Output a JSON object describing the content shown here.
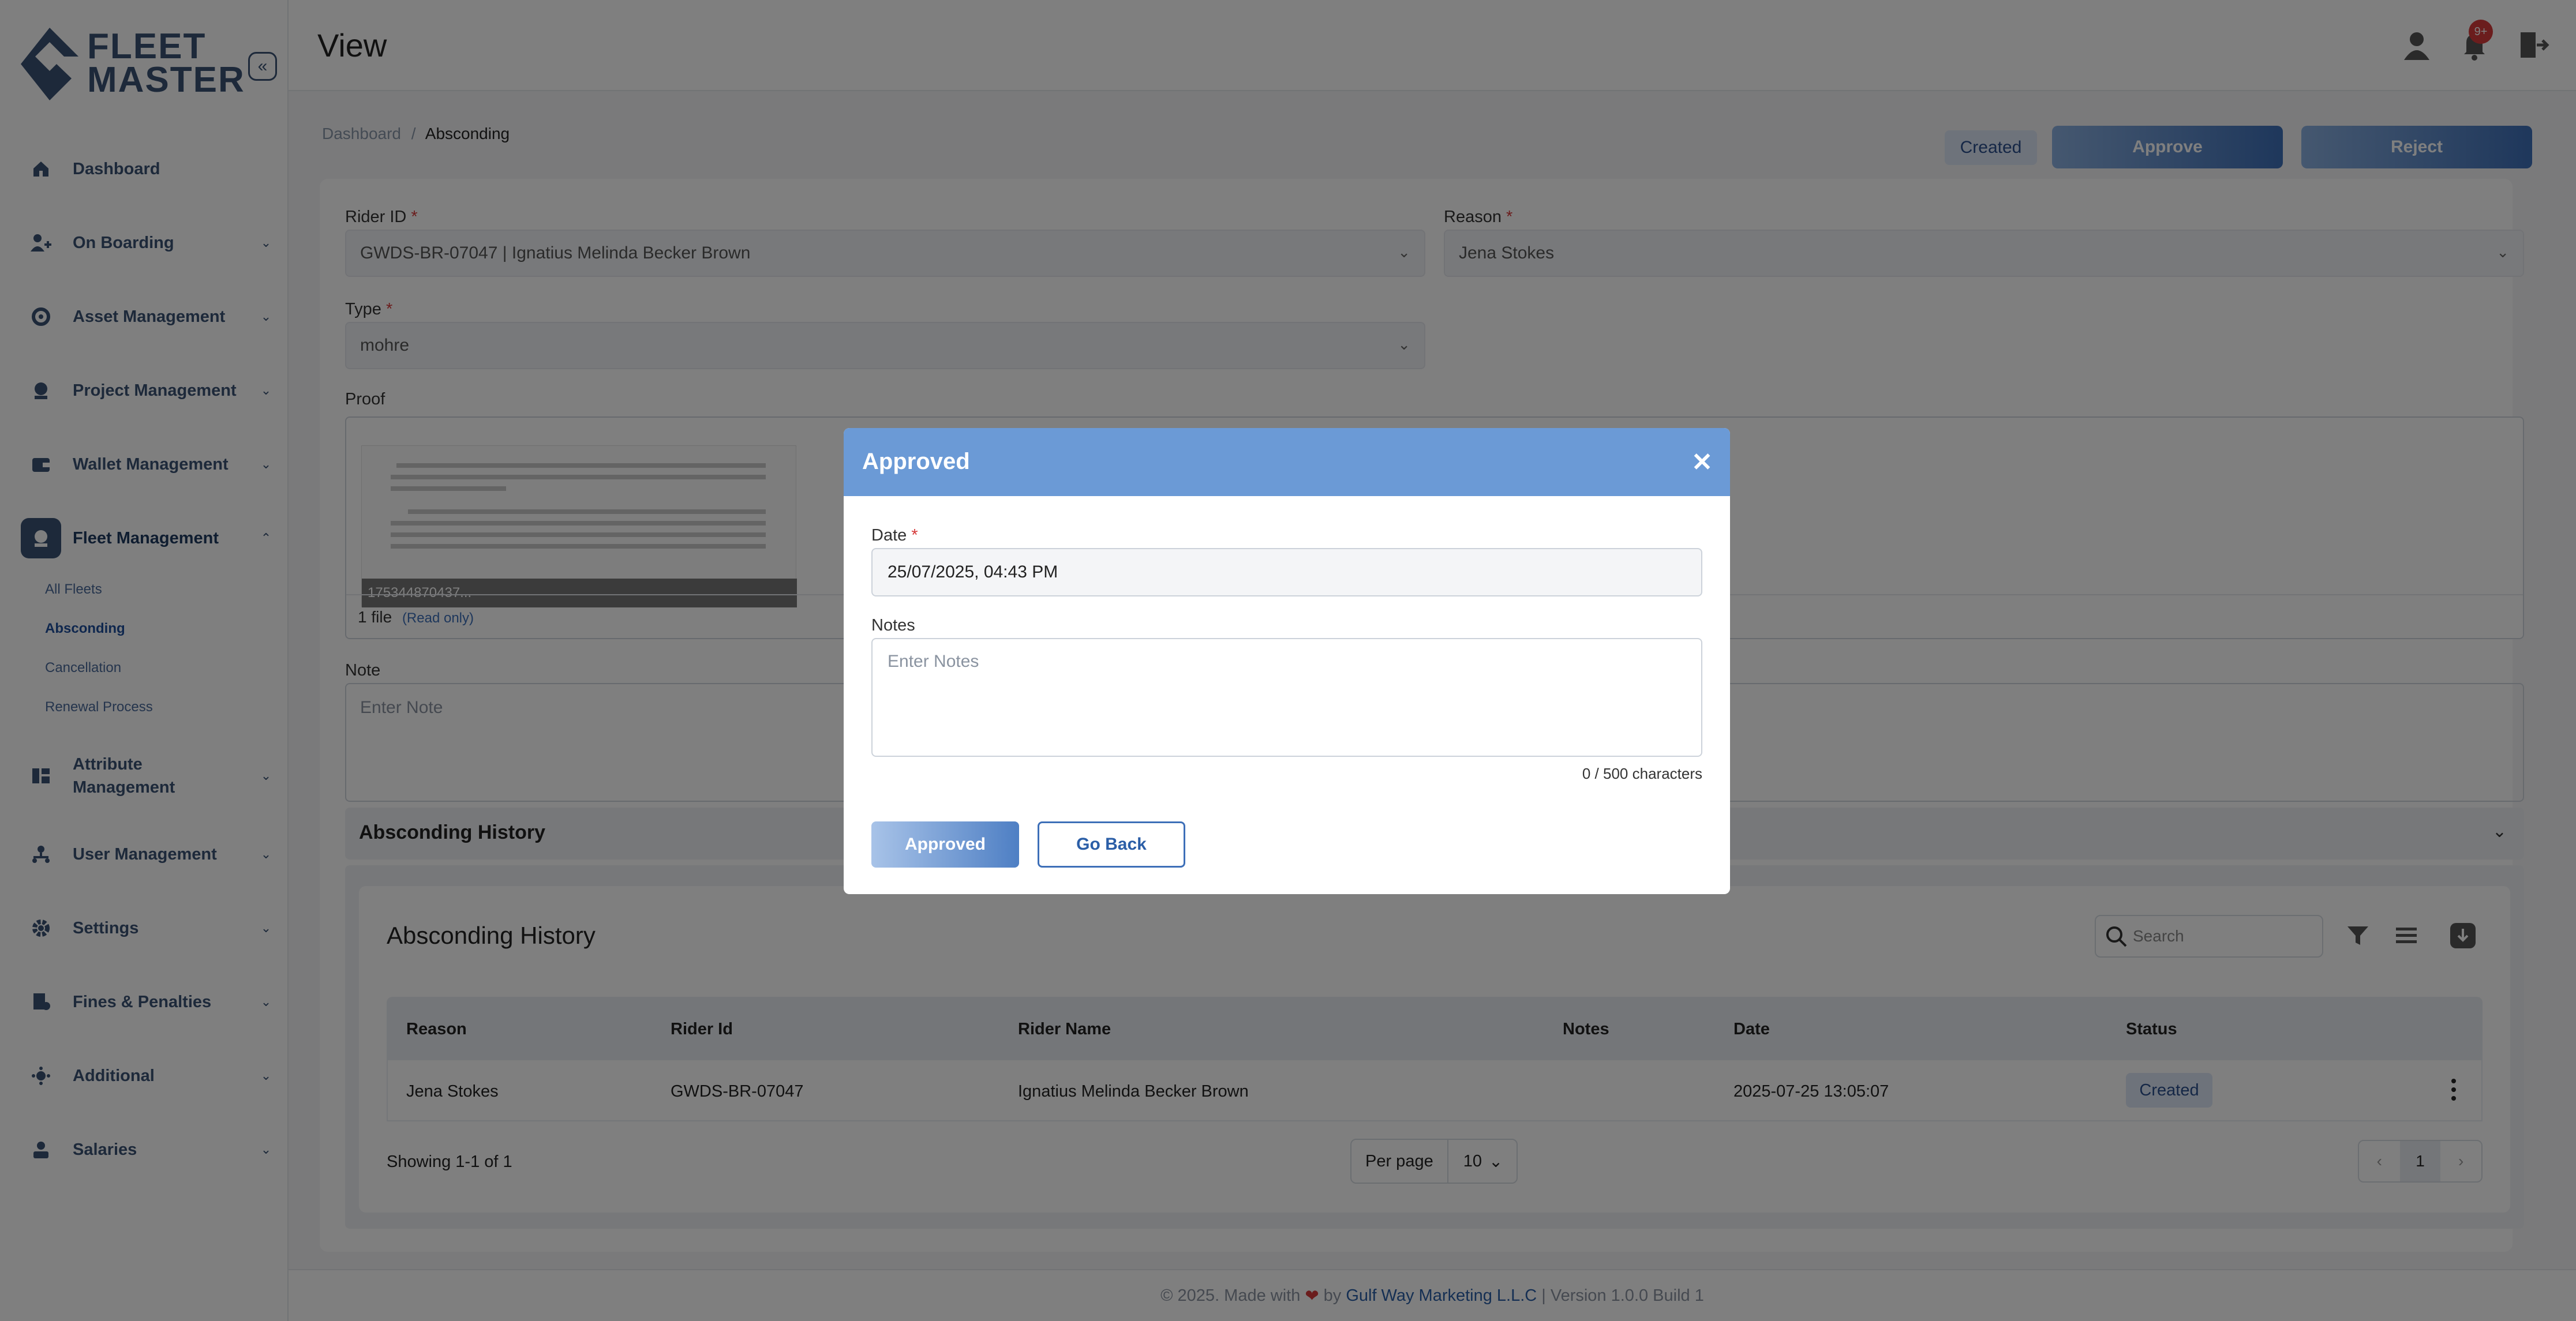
{
  "brand": {
    "logo_line1": "FLEET",
    "logo_line2": "MASTER"
  },
  "sidebar": {
    "items": [
      {
        "label": "Dashboard",
        "icon": "home-icon"
      },
      {
        "label": "On Boarding",
        "icon": "user-add-icon"
      },
      {
        "label": "Asset Management",
        "icon": "asset-icon"
      },
      {
        "label": "Project Management",
        "icon": "project-icon"
      },
      {
        "label": "Wallet Management",
        "icon": "wallet-icon"
      },
      {
        "label": "Fleet Management",
        "icon": "fleet-icon"
      },
      {
        "label_line1": "Attribute",
        "label_line2": "Management",
        "icon": "attribute-icon"
      },
      {
        "label": "User Management",
        "icon": "users-icon"
      },
      {
        "label": "Settings",
        "icon": "gear-icon"
      },
      {
        "label": "Fines & Penalties",
        "icon": "fines-icon"
      },
      {
        "label": "Additional",
        "icon": "additional-icon"
      },
      {
        "label": "Salaries",
        "icon": "salary-icon"
      }
    ],
    "fleet_sub": [
      "All Fleets",
      "Absconding",
      "Cancellation",
      "Renewal Process"
    ]
  },
  "header": {
    "title": "View",
    "notif_count": "9+"
  },
  "breadcrumb": {
    "home": "Dashboard",
    "sep": "/",
    "current": "Absconding"
  },
  "actions": {
    "status": "Created",
    "approve": "Approve",
    "reject": "Reject"
  },
  "form": {
    "rider_label": "Rider ID",
    "rider_value": "GWDS-BR-07047 | Ignatius Melinda Becker Brown",
    "reason_label": "Reason",
    "reason_value": "Jena Stokes",
    "type_label": "Type",
    "type_value": "mohre",
    "proof_label": "Proof",
    "proof_filename": "175344870437...",
    "proof_count": "1 file",
    "proof_readonly": "(Read only)",
    "note_label": "Note",
    "note_placeholder": "Enter Note",
    "req_mark": "*"
  },
  "history": {
    "accordion_title": "Absconding History",
    "title": "Absconding History",
    "search_placeholder": "Search",
    "columns": [
      "Reason",
      "Rider Id",
      "Rider Name",
      "Notes",
      "Date",
      "Status"
    ],
    "rows": [
      {
        "reason": "Jena Stokes",
        "rider_id": "GWDS-BR-07047",
        "rider_name": "Ignatius Melinda Becker Brown",
        "notes": "",
        "date": "2025-07-25 13:05:07",
        "status": "Created"
      }
    ],
    "showing": "Showing 1-1 of 1",
    "per_page_label": "Per page",
    "per_page_value": "10",
    "current_page": "1"
  },
  "footer": {
    "prefix": "© 2025. Made with",
    "by": "by",
    "company": "Gulf Way Marketing L.L.C",
    "suffix": "| Version 1.0.0 Build 1"
  },
  "modal": {
    "title": "Approved",
    "date_label": "Date",
    "date_value": "25/07/2025, 04:43 PM",
    "notes_label": "Notes",
    "notes_placeholder": "Enter Notes",
    "char_count": "0 / 500 characters",
    "approve_btn": "Approved",
    "back_btn": "Go Back"
  },
  "colors": {
    "primary": "#3b5375",
    "accent": "#3d6fb8",
    "modal_header": "#6b9ad6",
    "badge": "#d63a3a"
  }
}
